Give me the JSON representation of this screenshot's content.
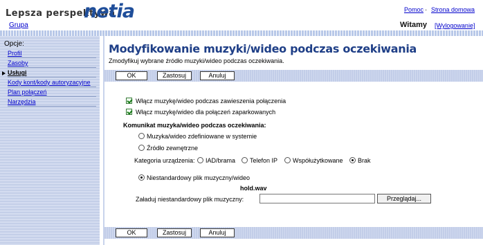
{
  "header": {
    "tagline": "Lepsza perspektywa",
    "logo": "netia",
    "group_link": "Grupa",
    "help_link": "Pomoc",
    "separator": "-",
    "home_link": "Strona domowa",
    "welcome": "Witamy",
    "logout_link": "[Wylogowanie]"
  },
  "sidebar": {
    "title": "Opcje:",
    "items": [
      {
        "label": "Profil"
      },
      {
        "label": "Zasoby"
      },
      {
        "label": "Usługi",
        "active": true
      },
      {
        "label": "Kody kont/kody autoryzacyjne"
      },
      {
        "label": "Plan połączeń"
      },
      {
        "label": "Narzędzia"
      }
    ]
  },
  "main": {
    "title": "Modyfikowanie muzyki/wideo podczas oczekiwania",
    "subtitle": "Zmodyfikuj wybrane źródło muzyki/wideo podczas oczekiwania.",
    "buttons": {
      "ok": "OK",
      "apply": "Zastosuj",
      "cancel": "Anuluj"
    },
    "options": {
      "enable_hold": "Włącz muzykę/wideo podczas zawieszenia połączenia",
      "enable_park": "Włącz muzykę/wideo dla połączeń zaparkowanych"
    },
    "announcement_label": "Komunikat muzyka/wideo podczas oczekiwania:",
    "source_system": "Muzyka/wideo zdefiniowane w systemie",
    "source_external": "Źródło zewnętrzne",
    "device_category_label": "Kategoria urządzenia:",
    "device_categories": [
      "IAD/brama",
      "Telefon IP",
      "Współużytkowane",
      "Brak"
    ],
    "device_selected": "Brak",
    "custom_file_label": "Niestandardowy plik muzyczny/wideo",
    "current_file": "hold.wav",
    "upload_label": "Załaduj niestandardowy plik muzyczny:",
    "upload_value": "",
    "browse_button": "Przeglądaj..."
  }
}
